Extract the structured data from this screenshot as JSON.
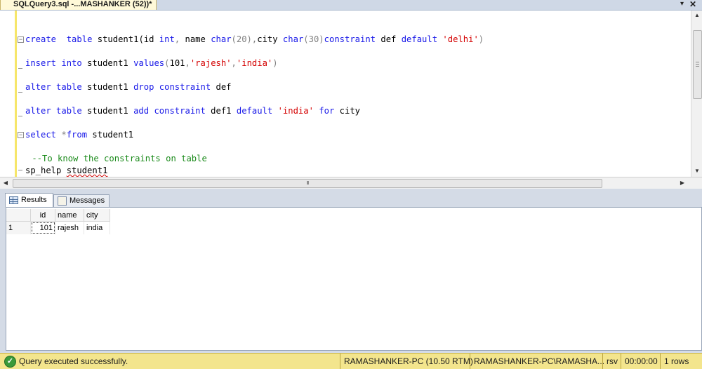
{
  "window": {
    "tab_title": "SQLQuery3.sql -...MASHANKER (52))*",
    "dropdown_glyph": "▾",
    "close_glyph": "✕"
  },
  "editor": {
    "lines": [
      {
        "segments": [
          [
            "kw",
            "create"
          ],
          [
            "",
            "  "
          ],
          [
            "kw",
            "table"
          ],
          [
            "",
            " student1(id "
          ],
          [
            "kw",
            "int"
          ],
          [
            "gray",
            ","
          ],
          [
            "",
            " name "
          ],
          [
            "kw",
            "char"
          ],
          [
            "gray",
            "(20),"
          ],
          [
            "",
            "city "
          ],
          [
            "kw",
            "char"
          ],
          [
            "gray",
            "(30)"
          ],
          [
            "kw",
            "constraint"
          ],
          [
            "",
            " def "
          ],
          [
            "kw",
            "default"
          ],
          [
            "",
            " "
          ],
          [
            "str",
            "'delhi'"
          ],
          [
            "gray",
            ")"
          ]
        ]
      },
      {
        "segments": [
          [
            "kw",
            "insert"
          ],
          [
            "",
            " "
          ],
          [
            "kw",
            "into"
          ],
          [
            "",
            " student1 "
          ],
          [
            "kw",
            "values"
          ],
          [
            "gray",
            "("
          ],
          [
            "",
            "101"
          ],
          [
            "gray",
            ","
          ],
          [
            "str",
            "'rajesh'"
          ],
          [
            "gray",
            ","
          ],
          [
            "str",
            "'india'"
          ],
          [
            "gray",
            ")"
          ]
        ]
      },
      {
        "segments": [
          [
            "kw",
            "alter"
          ],
          [
            "",
            " "
          ],
          [
            "kw",
            "table"
          ],
          [
            "",
            " student1 "
          ],
          [
            "kw",
            "drop"
          ],
          [
            "",
            " "
          ],
          [
            "kw",
            "constraint"
          ],
          [
            "",
            " def"
          ]
        ]
      },
      {
        "segments": [
          [
            "kw",
            "alter"
          ],
          [
            "",
            " "
          ],
          [
            "kw",
            "table"
          ],
          [
            "",
            " student1 "
          ],
          [
            "kw",
            "add"
          ],
          [
            "",
            " "
          ],
          [
            "kw",
            "constraint"
          ],
          [
            "",
            " def1 "
          ],
          [
            "kw",
            "default"
          ],
          [
            "",
            " "
          ],
          [
            "str",
            "'india'"
          ],
          [
            "",
            " "
          ],
          [
            "kw",
            "for"
          ],
          [
            "",
            " city"
          ]
        ]
      },
      {
        "segments": [
          [
            "kw",
            "select"
          ],
          [
            "",
            " "
          ],
          [
            "gray",
            "*"
          ],
          [
            "kw",
            "from"
          ],
          [
            "",
            " student1"
          ]
        ]
      },
      {
        "segments": [
          [
            "cm",
            " --To know the constraints on table"
          ]
        ]
      },
      {
        "segments": [
          [
            "",
            "sp_help "
          ],
          [
            "squig",
            "student1"
          ]
        ]
      }
    ]
  },
  "scroll": {
    "up": "▲",
    "down": "▼",
    "left": "◀",
    "right": "▶",
    "h_grip": "III"
  },
  "results_tabs": [
    {
      "label": "Results",
      "active": true
    },
    {
      "label": "Messages",
      "active": false
    }
  ],
  "grid": {
    "columns": [
      "id",
      "name",
      "city"
    ],
    "rows": [
      {
        "rownum": "1",
        "id": "101",
        "name": "rajesh",
        "city": "india"
      }
    ]
  },
  "status": {
    "message": "Query executed successfully.",
    "server": "RAMASHANKER-PC (10.50 RTM)",
    "login": "RAMASHANKER-PC\\RAMASHA...",
    "database": "rsv",
    "elapsed": "00:00:00",
    "rows": "1 rows"
  }
}
